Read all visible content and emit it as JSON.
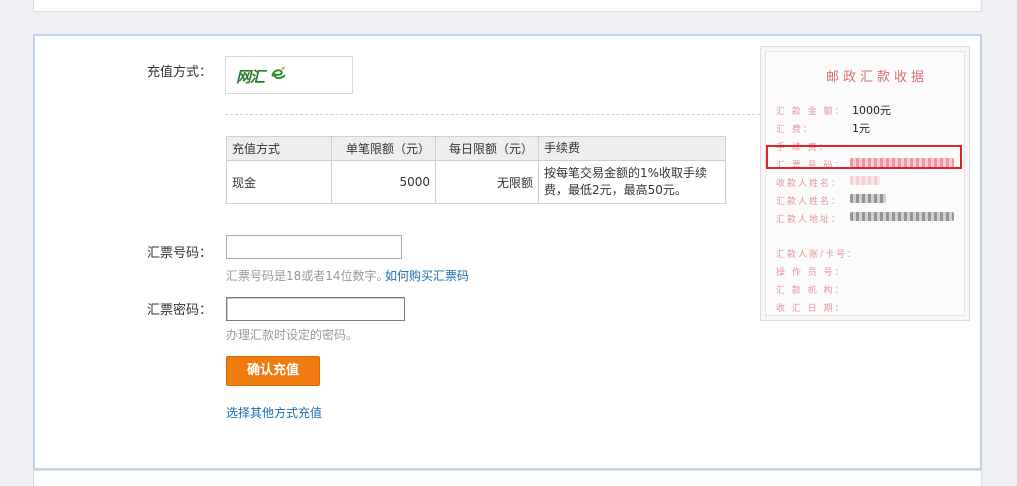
{
  "form": {
    "method_label": "充值方式：",
    "number_label": "汇票号码：",
    "password_label": "汇票密码：",
    "logo_text": "网汇e",
    "number_placeholder": "",
    "password_placeholder": "",
    "number_hint": "汇票号码是18或者14位数字。",
    "buy_link": "如何购买汇票码",
    "password_hint": "办理汇款时设定的密码。",
    "submit_label": "确认充值",
    "other_methods_link": "选择其他方式充值"
  },
  "limits_table": {
    "headers": [
      "充值方式",
      "单笔限额（元）",
      "每日限额（元）",
      "手续费"
    ],
    "rows": [
      [
        "现金",
        "5000",
        "无限额",
        "按每笔交易金额的1%收取手续费，最低2元，最高50元。"
      ]
    ]
  },
  "receipt": {
    "title": "邮政汇款收据",
    "rows": [
      {
        "label": "汇 款 金 额：",
        "value": "1000元"
      },
      {
        "label": "汇        费：",
        "value": "1元"
      },
      {
        "label": "手 续 费：",
        "value": ""
      },
      {
        "label": "汇 票 号 码：",
        "value": ""
      },
      {
        "label": "收款人姓名：",
        "value": ""
      },
      {
        "label": "汇款人姓名：",
        "value": ""
      },
      {
        "label": "汇款人地址：",
        "value": ""
      },
      {
        "label": "汇款人账/卡号：",
        "value": ""
      },
      {
        "label": "操 作 员 号：",
        "value": ""
      },
      {
        "label": "汇 款 机 构：",
        "value": ""
      },
      {
        "label": "收 汇 日 期：",
        "value": ""
      }
    ]
  },
  "colors": {
    "button": "#f07b0f",
    "link": "#1a6fb0",
    "highlight": "#e0232d",
    "panel_border": "#c3d2ef"
  }
}
